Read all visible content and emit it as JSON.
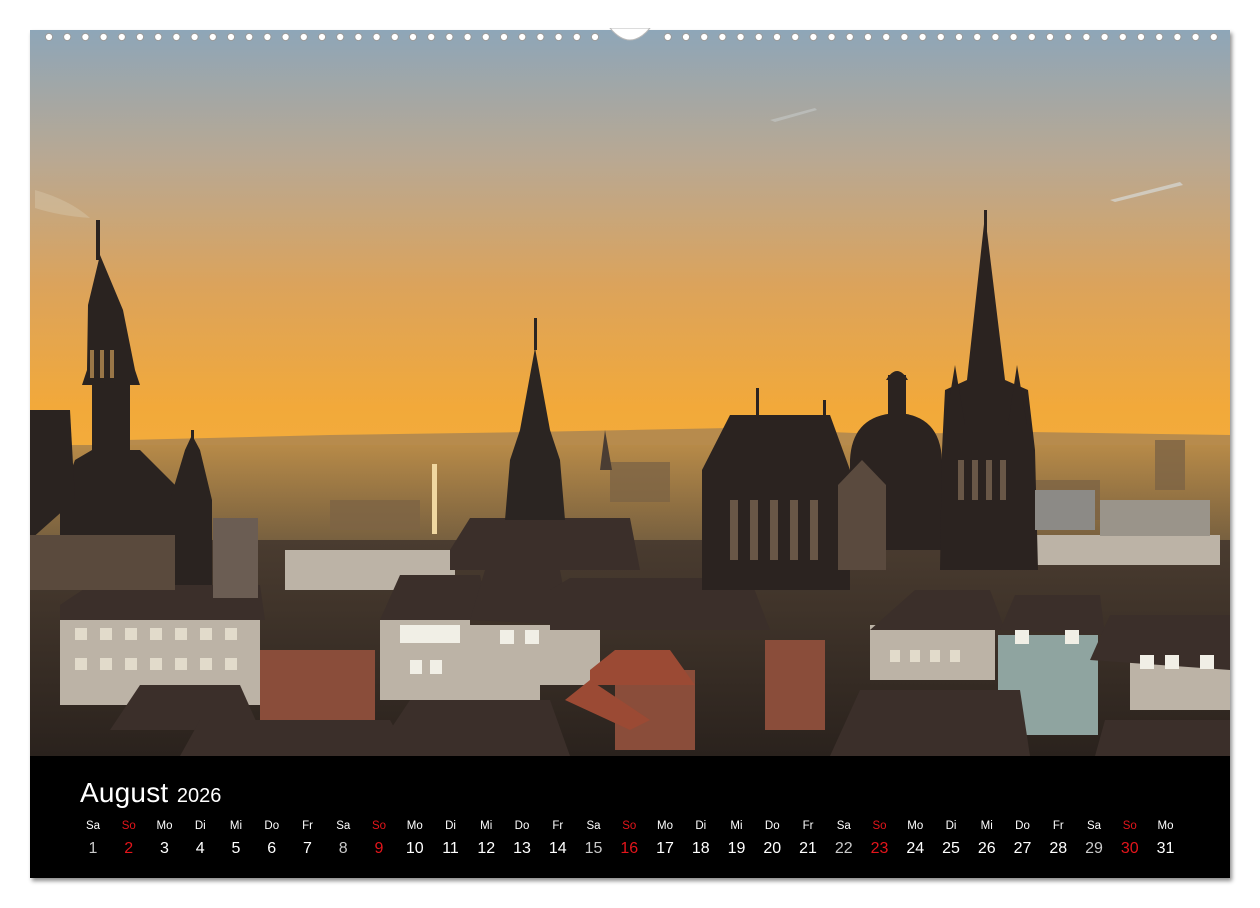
{
  "calendar": {
    "month": "August",
    "year": "2026",
    "days": [
      {
        "weekday": "Sa",
        "date": "1",
        "type": "saturday"
      },
      {
        "weekday": "So",
        "date": "2",
        "type": "sunday"
      },
      {
        "weekday": "Mo",
        "date": "3",
        "type": "weekday"
      },
      {
        "weekday": "Di",
        "date": "4",
        "type": "weekday"
      },
      {
        "weekday": "Mi",
        "date": "5",
        "type": "weekday"
      },
      {
        "weekday": "Do",
        "date": "6",
        "type": "weekday"
      },
      {
        "weekday": "Fr",
        "date": "7",
        "type": "weekday"
      },
      {
        "weekday": "Sa",
        "date": "8",
        "type": "saturday"
      },
      {
        "weekday": "So",
        "date": "9",
        "type": "sunday"
      },
      {
        "weekday": "Mo",
        "date": "10",
        "type": "weekday"
      },
      {
        "weekday": "Di",
        "date": "11",
        "type": "weekday"
      },
      {
        "weekday": "Mi",
        "date": "12",
        "type": "weekday"
      },
      {
        "weekday": "Do",
        "date": "13",
        "type": "weekday"
      },
      {
        "weekday": "Fr",
        "date": "14",
        "type": "weekday"
      },
      {
        "weekday": "Sa",
        "date": "15",
        "type": "saturday"
      },
      {
        "weekday": "So",
        "date": "16",
        "type": "sunday"
      },
      {
        "weekday": "Mo",
        "date": "17",
        "type": "weekday"
      },
      {
        "weekday": "Di",
        "date": "18",
        "type": "weekday"
      },
      {
        "weekday": "Mi",
        "date": "19",
        "type": "weekday"
      },
      {
        "weekday": "Do",
        "date": "20",
        "type": "weekday"
      },
      {
        "weekday": "Fr",
        "date": "21",
        "type": "weekday"
      },
      {
        "weekday": "Sa",
        "date": "22",
        "type": "saturday"
      },
      {
        "weekday": "So",
        "date": "23",
        "type": "sunday"
      },
      {
        "weekday": "Mo",
        "date": "24",
        "type": "weekday"
      },
      {
        "weekday": "Di",
        "date": "25",
        "type": "weekday"
      },
      {
        "weekday": "Mi",
        "date": "26",
        "type": "weekday"
      },
      {
        "weekday": "Do",
        "date": "27",
        "type": "weekday"
      },
      {
        "weekday": "Fr",
        "date": "28",
        "type": "weekday"
      },
      {
        "weekday": "Sa",
        "date": "29",
        "type": "saturday"
      },
      {
        "weekday": "So",
        "date": "30",
        "type": "sunday"
      },
      {
        "weekday": "Mo",
        "date": "31",
        "type": "weekday"
      }
    ]
  },
  "colors": {
    "sunday": "#e3151b",
    "calendar_background": "#000000",
    "calendar_text": "#ffffff",
    "sky_top": "#8ea6b8",
    "sky_horizon": "#f2a93a"
  },
  "photo": {
    "subject": "city-skyline-with-cathedral-at-sunset"
  }
}
